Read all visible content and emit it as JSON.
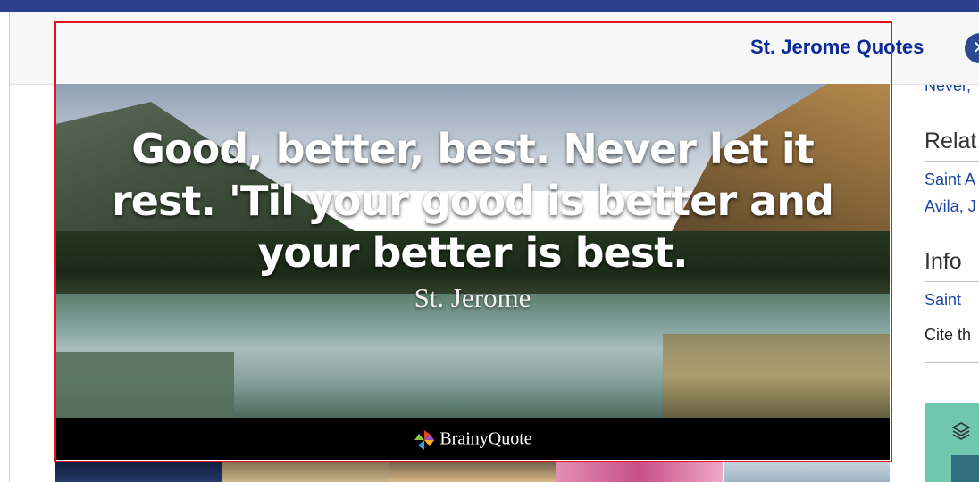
{
  "header": {
    "title": "St. Jerome Quotes",
    "close_icon": "close-icon"
  },
  "sidebar": {
    "partial_link": "Never,",
    "related_heading": "Relat",
    "related_links": [
      "Saint A",
      "Avila, J"
    ],
    "info_heading": "Info",
    "info_link": "Saint",
    "cite_text": "Cite th"
  },
  "quote": {
    "line1": "Good, better, best. Never let it",
    "line2": "rest. 'Til your good is better and",
    "line3": "your better is best.",
    "author": "St. Jerome",
    "brand": "BrainyQuote"
  },
  "colors": {
    "topbar": "#2c3e8c",
    "link": "#1a44a8",
    "title": "#0a2b9c",
    "highlight": "#e0141e",
    "close_bg": "#2c4a8f"
  },
  "thumbnails": [
    "night-sky-thumbnail",
    "mountain-thumbnail",
    "sunset-thumbnail",
    "cherry-blossom-thumbnail",
    "sky-thumbnail"
  ]
}
